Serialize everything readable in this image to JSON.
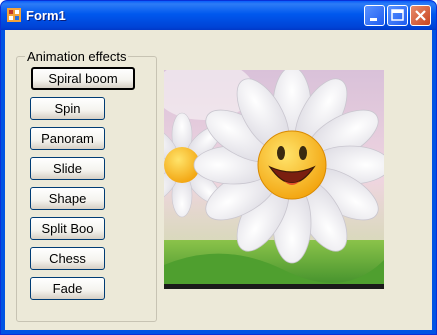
{
  "window": {
    "title": "Form1"
  },
  "group": {
    "label": "Animation effects"
  },
  "buttons": [
    {
      "label": "Spiral boom"
    },
    {
      "label": "Spin"
    },
    {
      "label": "Panoram"
    },
    {
      "label": "Slide"
    },
    {
      "label": "Shape"
    },
    {
      "label": "Split Boo"
    },
    {
      "label": "Chess"
    },
    {
      "label": "Fade"
    }
  ],
  "icons": {
    "app": "form-app-icon",
    "minimize": "minimize-icon",
    "maximize": "maximize-icon",
    "close": "close-icon"
  },
  "colors": {
    "titlebar": "#0054e3",
    "client": "#ece9d8",
    "button_border": "#003c74"
  }
}
